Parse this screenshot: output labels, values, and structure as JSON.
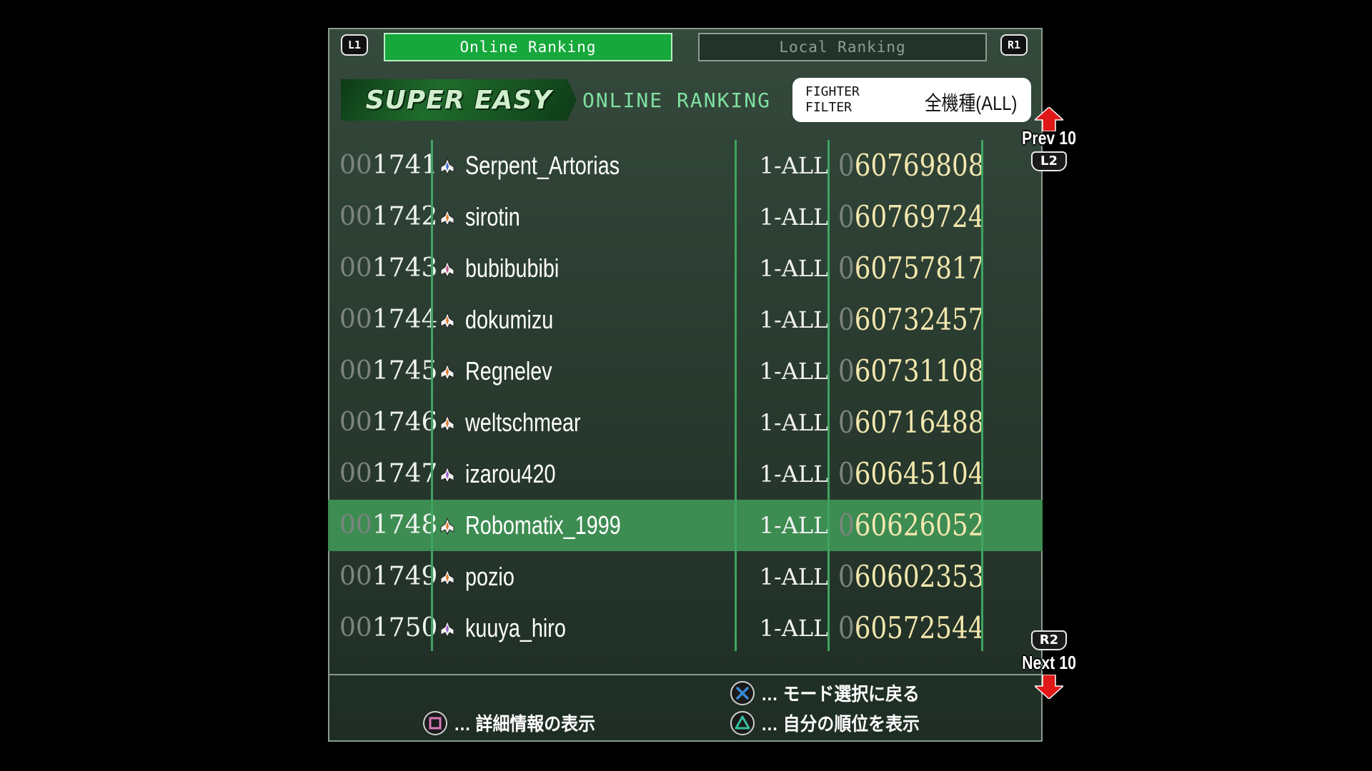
{
  "tabs": {
    "l1_label": "L1",
    "r1_label": "R1",
    "online": "Online Ranking",
    "local": "Local Ranking"
  },
  "header": {
    "difficulty": "SUPER EASY",
    "subtitle": "ONLINE RANKING",
    "filter_label_1": "FIGHTER",
    "filter_label_2": "FILTER",
    "filter_value": "全機種(ALL)"
  },
  "nav": {
    "prev_label": "Prev 10",
    "prev_button": "L2",
    "next_label": "Next 10",
    "next_button": "R2"
  },
  "rows": [
    {
      "rank_pad": "00",
      "rank": "1741",
      "ship_color": "#3b6fd8",
      "name": "Serpent_Artorias",
      "stage": "1-ALL",
      "score_pad": "0",
      "score": "60769808"
    },
    {
      "rank_pad": "00",
      "rank": "1742",
      "ship_color": "#e07a2a",
      "name": "sirotin",
      "stage": "1-ALL",
      "score_pad": "0",
      "score": "60769724"
    },
    {
      "rank_pad": "00",
      "rank": "1743",
      "ship_color": "#c0508a",
      "name": "bubibubibi",
      "stage": "1-ALL",
      "score_pad": "0",
      "score": "60757817"
    },
    {
      "rank_pad": "00",
      "rank": "1744",
      "ship_color": "#e07a2a",
      "name": "dokumizu",
      "stage": "1-ALL",
      "score_pad": "0",
      "score": "60732457"
    },
    {
      "rank_pad": "00",
      "rank": "1745",
      "ship_color": "#e07a2a",
      "name": "Regnelev",
      "stage": "1-ALL",
      "score_pad": "0",
      "score": "60731108"
    },
    {
      "rank_pad": "00",
      "rank": "1746",
      "ship_color": "#e07a2a",
      "name": "weltschmear",
      "stage": "1-ALL",
      "score_pad": "0",
      "score": "60716488"
    },
    {
      "rank_pad": "00",
      "rank": "1747",
      "ship_color": "#9a5ad0",
      "name": "izarou420",
      "stage": "1-ALL",
      "score_pad": "0",
      "score": "60645104"
    },
    {
      "rank_pad": "00",
      "rank": "1748",
      "ship_color": "#e07a2a",
      "name": "Robomatix_1999",
      "stage": "1-ALL",
      "score_pad": "0",
      "score": "60626052",
      "selected": true
    },
    {
      "rank_pad": "00",
      "rank": "1749",
      "ship_color": "#e07a2a",
      "name": "pozio",
      "stage": "1-ALL",
      "score_pad": "0",
      "score": "60602353"
    },
    {
      "rank_pad": "00",
      "rank": "1750",
      "ship_color": "#9a5ad0",
      "name": "kuuya_hiro",
      "stage": "1-ALL",
      "score_pad": "0",
      "score": "60572544"
    }
  ],
  "hints": {
    "cross": "… モード選択に戻る",
    "square": "… 詳細情報の表示",
    "triangle": "… 自分の順位を表示"
  },
  "colors": {
    "active_tab": "#16a83b",
    "selected_row": "#3d8c52",
    "score_text": "#f3e7ae",
    "arrow": "#e01818",
    "cross_button": "#3a8ad8",
    "square_button": "#d878b8",
    "triangle_button": "#35c0a0"
  }
}
